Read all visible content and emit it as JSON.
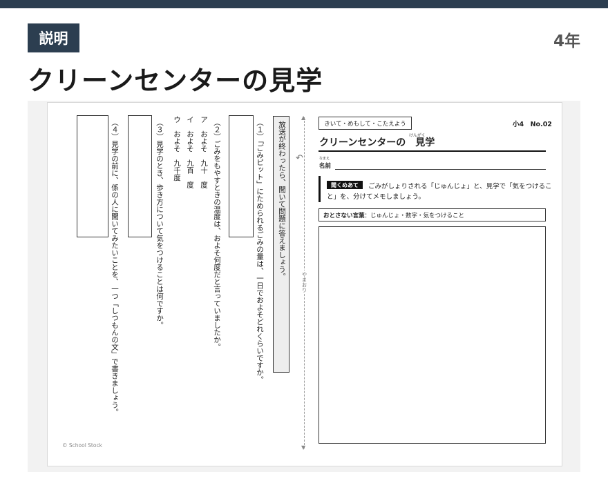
{
  "header": {
    "badge": "説明",
    "grade": "4年",
    "title": "クリーンセンターの見学"
  },
  "worksheet": {
    "instruction": "放送が終わったら、聞いて問題に答えましょう。",
    "questions": {
      "q1": "（１）「ごみピット」にためられるごみの量は、一日でおよそどれくらいですか。",
      "q2": "（２）ごみをもやすときの温度は、およそ何度だと言っていましたか。",
      "q2_options": [
        "ア　およそ　九十　度",
        "イ　およそ　九百　度",
        "ウ　およそ　九千度"
      ],
      "q3": "（３）見学のとき、歩き方について気をつけることは何ですか。",
      "q4_line1": "（４）見学の前に、係の人に聞いてみたいことを、一つ「しつもんの文」で書きましょう。"
    },
    "fold_label": "やまおり",
    "copyright": "© School Stock",
    "listen_label": "きいて・めもして・こたえよう",
    "sheet_no": "小4　No.02",
    "sheet_title": "クリーンセンターの　見学",
    "sheet_title_ruby": "けんがく",
    "name_label": "名前",
    "name_ruby": "なまえ",
    "aim_tag": "聞くめあて",
    "aim_text_line1": "ごみがしょりされる「じゅんじょ」と、見学で「気をつけるこ",
    "aim_text_line2": "と」を、分けてメモしましょう。",
    "words_label": "おとさない言葉",
    "words_text": "：じゅんじょ・数字・気をつけること"
  }
}
